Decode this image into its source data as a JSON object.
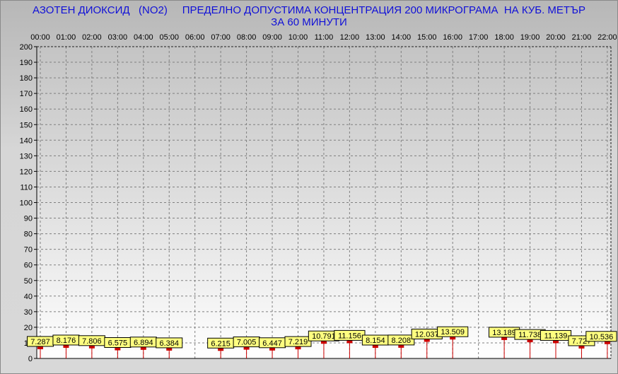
{
  "title_line1": "АЗОТЕН ДИОКСИД   (NO2)     ПРЕДЕЛНО ДОПУСТИМА КОНЦЕНТРАЦИЯ 200 МИКРОГРАМА  НА КУБ. МЕТЪР",
  "title_line2": "ЗА 60 МИНУТИ",
  "colors": {
    "title": "#1010d8",
    "marker": "#cc0000",
    "label_bg": "#ffff80",
    "grid": "#808080"
  },
  "chart_data": {
    "type": "bar",
    "title": "АЗОТЕН ДИОКСИД   (NO2)     ПРЕДЕЛНО ДОПУСТИМА КОНЦЕНТРАЦИЯ 200 МИКРОГРАМА  НА КУБ. МЕТЪР ЗА 60 МИНУТИ",
    "xlabel": "",
    "ylabel": "",
    "ylim": [
      0,
      200
    ],
    "ytick_step": 10,
    "grid": true,
    "categories": [
      "00:00",
      "01:00",
      "02:00",
      "03:00",
      "04:00",
      "05:00",
      "06:00",
      "07:00",
      "08:00",
      "09:00",
      "10:00",
      "11:00",
      "12:00",
      "13:00",
      "14:00",
      "15:00",
      "16:00",
      "17:00",
      "18:00",
      "19:00",
      "20:00",
      "21:00",
      "22:00"
    ],
    "values": [
      7.287,
      8.176,
      7.806,
      6.575,
      6.894,
      6.384,
      null,
      6.215,
      7.005,
      6.447,
      7.219,
      10.791,
      11.156,
      8.154,
      8.208,
      12.037,
      13.509,
      null,
      13.189,
      11.738,
      11.139,
      7.727,
      10.536
    ],
    "data_labels": [
      "7.287",
      "8.176",
      "7.806",
      "6.575",
      "6.894",
      "6.384",
      "",
      "6.215",
      "7.005",
      "6.447",
      "7.219",
      "10.791",
      "11.156",
      "8.154",
      "8.208",
      "12.037",
      "13.509",
      "",
      "13.189",
      "11.738",
      "11.139",
      "7.727",
      "10.536"
    ]
  }
}
